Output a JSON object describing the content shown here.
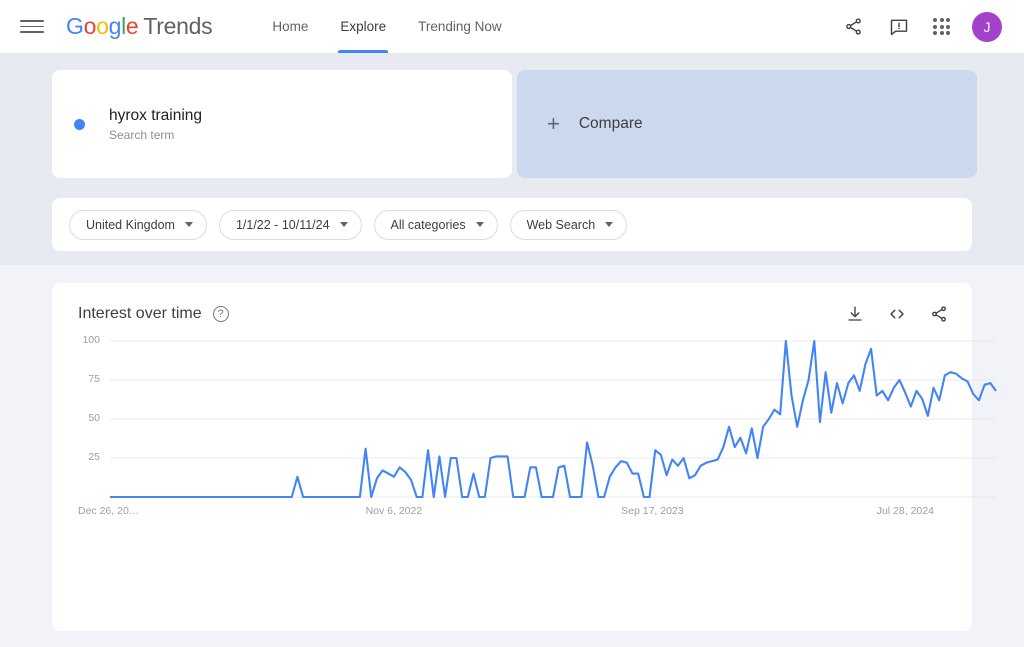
{
  "header": {
    "menu_icon": "hamburger-icon",
    "logo_letters": [
      "G",
      "o",
      "o",
      "g",
      "l",
      "e"
    ],
    "logo_suffix": "Trends",
    "nav": [
      {
        "label": "Home",
        "active": false
      },
      {
        "label": "Explore",
        "active": true
      },
      {
        "label": "Trending Now",
        "active": false
      }
    ],
    "icons": [
      "share-icon",
      "feedback-icon",
      "apps-grid-icon"
    ],
    "avatar_initial": "J"
  },
  "search_terms": {
    "term": {
      "name": "hyrox training",
      "subtitle": "Search term",
      "dot_color": "#4285F4"
    },
    "compare": {
      "label": "Compare",
      "plus": "+"
    }
  },
  "filters": [
    {
      "name": "location-filter",
      "label": "United Kingdom"
    },
    {
      "name": "date-range-filter",
      "label": "1/1/22 - 10/11/24"
    },
    {
      "name": "category-filter",
      "label": "All categories"
    },
    {
      "name": "search-type-filter",
      "label": "Web Search"
    }
  ],
  "chart_panel": {
    "title": "Interest over time",
    "help": "?",
    "actions": [
      "download-icon",
      "embed-icon",
      "share-icon"
    ]
  },
  "chart_data": {
    "type": "line",
    "title": "Interest over time",
    "xlabel": "",
    "ylabel": "",
    "ylim": [
      0,
      100
    ],
    "yticks": [
      100,
      75,
      50,
      25
    ],
    "grid": true,
    "legend": false,
    "line_color": "#4285F4",
    "xtick_labels": [
      "Dec 26, 20…",
      "Nov 6, 2022",
      "Sep 17, 2023",
      "Jul 28, 2024"
    ],
    "xtick_positions": [
      0,
      45,
      90,
      135
    ],
    "series": [
      {
        "name": "hyrox training",
        "values": [
          0,
          0,
          0,
          0,
          0,
          0,
          0,
          0,
          0,
          0,
          0,
          0,
          0,
          0,
          0,
          0,
          0,
          0,
          0,
          0,
          0,
          0,
          0,
          0,
          0,
          0,
          0,
          0,
          0,
          0,
          0,
          0,
          0,
          13,
          0,
          0,
          0,
          0,
          0,
          0,
          0,
          0,
          0,
          0,
          0,
          31,
          0,
          12,
          17,
          15,
          13,
          19,
          16,
          11,
          0,
          0,
          30,
          0,
          26,
          0,
          25,
          25,
          0,
          0,
          15,
          0,
          0,
          25,
          26,
          26,
          26,
          0,
          0,
          0,
          19,
          19,
          0,
          0,
          0,
          19,
          20,
          0,
          0,
          0,
          35,
          20,
          0,
          0,
          13,
          19,
          23,
          22,
          15,
          15,
          0,
          0,
          30,
          27,
          14,
          24,
          20,
          25,
          12,
          14,
          20,
          22,
          23,
          24,
          32,
          45,
          32,
          38,
          28,
          44,
          25,
          45,
          50,
          56,
          53,
          100,
          65,
          45,
          62,
          75,
          100,
          48,
          80,
          54,
          73,
          60,
          73,
          78,
          68,
          85,
          95,
          65,
          68,
          62,
          70,
          75,
          67,
          58,
          68,
          63,
          52,
          70,
          62,
          78,
          80,
          79,
          76,
          74,
          66,
          62,
          72,
          73,
          68
        ]
      }
    ]
  }
}
